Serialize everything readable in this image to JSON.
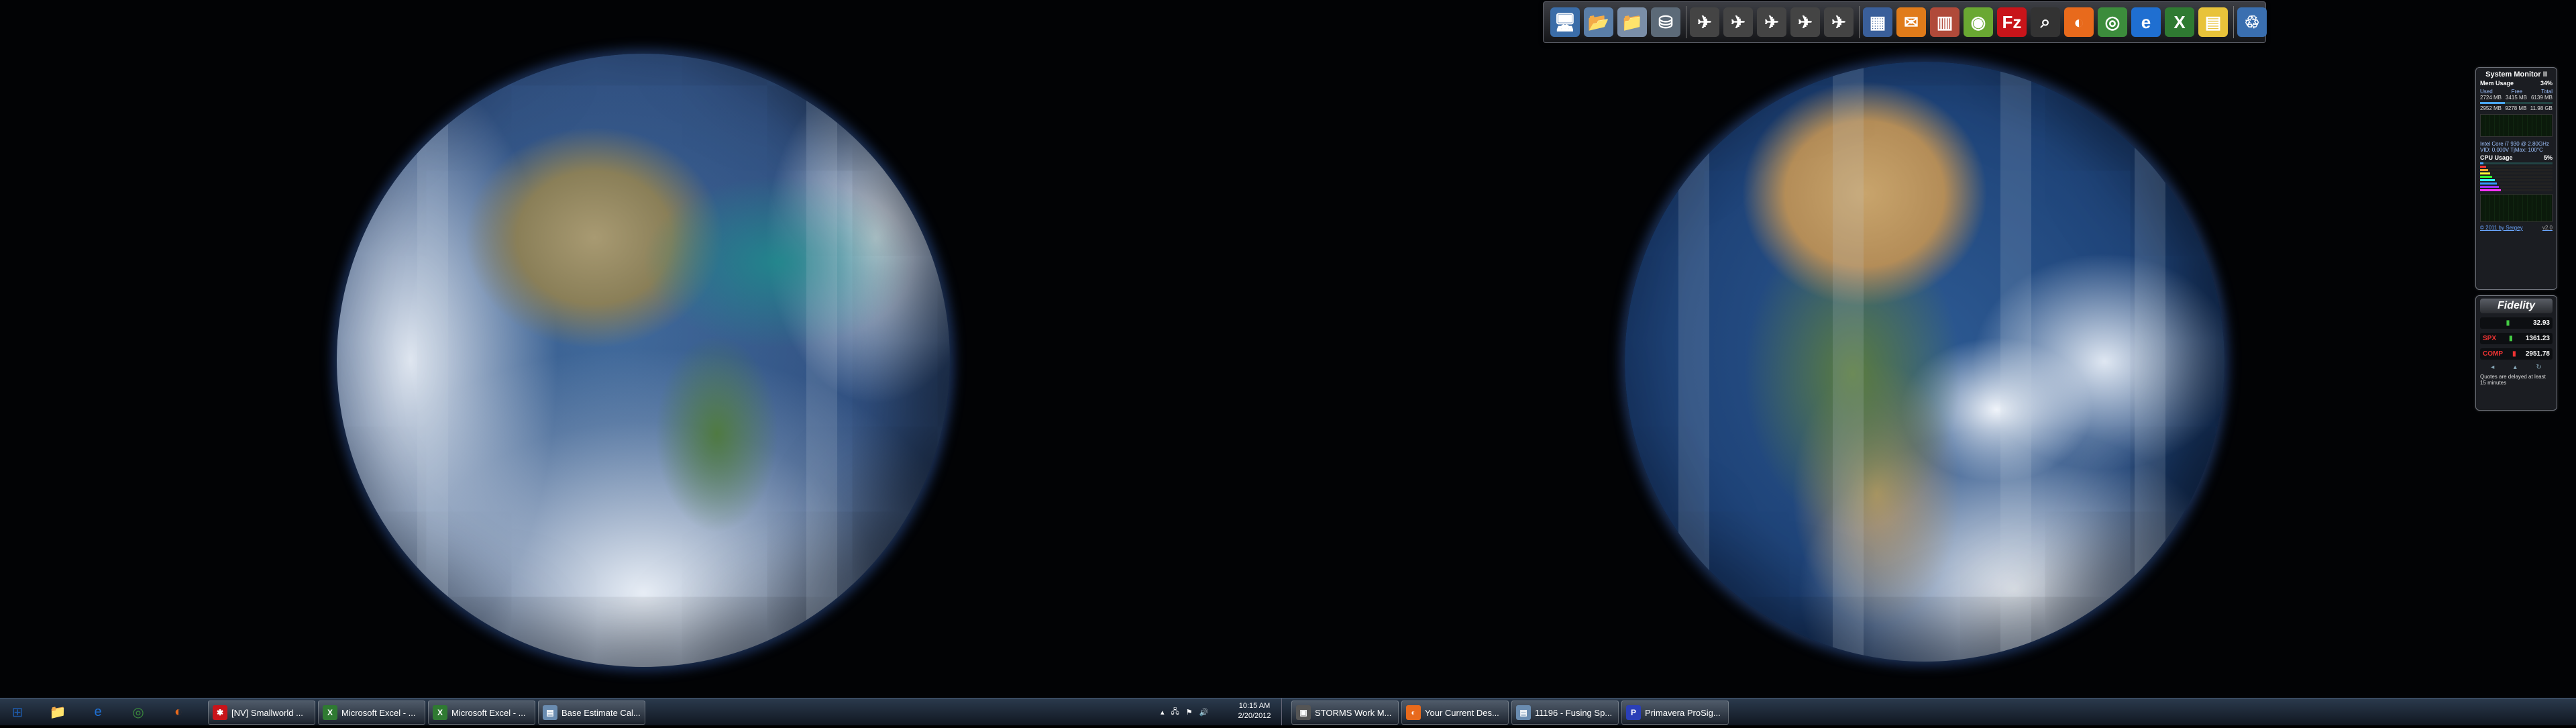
{
  "desktop": {
    "left_wallpaper": "earth-americas",
    "right_wallpaper": "earth-africa-indian-ocean"
  },
  "dock": {
    "icons": [
      {
        "name": "computer-icon",
        "glyph": "🖥",
        "color": "#3b6da8"
      },
      {
        "name": "folder-icon",
        "glyph": "📂",
        "color": "#5a7ea8"
      },
      {
        "name": "folder-open-icon",
        "glyph": "📁",
        "color": "#7a8ea8"
      },
      {
        "name": "drive-icon",
        "glyph": "⛁",
        "color": "#5c6a78"
      },
      {
        "name": "plane-icon-1",
        "glyph": "✈",
        "color": "#444"
      },
      {
        "name": "plane-icon-2",
        "glyph": "✈",
        "color": "#444"
      },
      {
        "name": "plane-icon-3",
        "glyph": "✈",
        "color": "#444"
      },
      {
        "name": "plane-icon-4",
        "glyph": "✈",
        "color": "#444"
      },
      {
        "name": "plane-icon-5",
        "glyph": "✈",
        "color": "#444"
      },
      {
        "name": "building-icon",
        "glyph": "▦",
        "color": "#3a5f9a"
      },
      {
        "name": "mail-icon",
        "glyph": "✉",
        "color": "#e07b1a"
      },
      {
        "name": "books-icon",
        "glyph": "▥",
        "color": "#b04a3a"
      },
      {
        "name": "android-icon",
        "glyph": "◉",
        "color": "#6aa832"
      },
      {
        "name": "filezilla-icon",
        "glyph": "Fz",
        "color": "#c8141a"
      },
      {
        "name": "magnifier-icon",
        "glyph": "⌕",
        "color": "#333"
      },
      {
        "name": "firefox-icon",
        "glyph": "◐",
        "color": "#e86a1c"
      },
      {
        "name": "chrome-icon",
        "glyph": "◎",
        "color": "#3c8c3c"
      },
      {
        "name": "ie-icon",
        "glyph": "e",
        "color": "#1f6fd1"
      },
      {
        "name": "excel-icon",
        "glyph": "X",
        "color": "#2f7a32"
      },
      {
        "name": "sticky-note-icon",
        "glyph": "▤",
        "color": "#e8c33a"
      },
      {
        "name": "recycle-bin-icon",
        "glyph": "♲",
        "color": "#3a6fb0"
      }
    ]
  },
  "system_monitor": {
    "title": "System Monitor II",
    "mem_label": "Mem Usage",
    "mem_percent": "34%",
    "mem_fill": 0.34,
    "col_headers": [
      "Used",
      "Free",
      "Total"
    ],
    "rows": [
      [
        "2724 MB",
        "3415 MB",
        "6139 MB"
      ],
      [
        "2952 MB",
        "9278 MB",
        "11.98 GB"
      ]
    ],
    "cpu_name": "Intel Core i7 930 @ 2.80GHz",
    "cpu_line2": "VID: 0.000V   TjMax: 100°C",
    "cpu_label": "CPU Usage",
    "cpu_percent": "5%",
    "cpu_fill": 0.05,
    "footer": "© 2011 by Sergey",
    "footer_right": "v2.0"
  },
  "fidelity": {
    "brand": "Fidelity",
    "quotes": [
      {
        "symbol": "",
        "value": "32.93",
        "color": "#4c4"
      },
      {
        "symbol": "SPX",
        "value": "1361.23",
        "color": "#4c4"
      },
      {
        "symbol": "COMP",
        "value": "2951.78",
        "color": "#e33"
      }
    ],
    "note": "Quotes are delayed at least 15 minutes"
  },
  "taskbar": {
    "pinned": [
      {
        "name": "start-button-icon",
        "glyph": "⊞",
        "color": "#1e5aa8"
      },
      {
        "name": "explorer-icon",
        "glyph": "📁",
        "color": "#d9a93a"
      },
      {
        "name": "ie-icon",
        "glyph": "e",
        "color": "#1f6fd1"
      },
      {
        "name": "chrome-icon",
        "glyph": "◎",
        "color": "#3c8c3c"
      },
      {
        "name": "firefox-icon",
        "glyph": "◐",
        "color": "#e86a1c"
      }
    ],
    "left_buttons": [
      {
        "label": "[NV] Smallworld ...",
        "glyph": "✱",
        "color": "#c8141a"
      },
      {
        "label": "Microsoft Excel - ...",
        "glyph": "X",
        "color": "#2f7a32"
      },
      {
        "label": "Microsoft Excel - ...",
        "glyph": "X",
        "color": "#2f7a32"
      },
      {
        "label": "Base Estimate Cal...",
        "glyph": "▤",
        "color": "#6a8cb0"
      }
    ],
    "clock_time": "10:15 AM",
    "clock_date": "2/20/2012",
    "right_buttons": [
      {
        "label": "STORMS Work M...",
        "glyph": "▣",
        "color": "#555"
      },
      {
        "label": "Your Current Des...",
        "glyph": "◐",
        "color": "#e86a1c"
      },
      {
        "label": "11196 - Fusing Sp...",
        "glyph": "▤",
        "color": "#6a8cb0"
      },
      {
        "label": "Primavera ProSig...",
        "glyph": "P",
        "color": "#2a3fb8"
      }
    ]
  }
}
